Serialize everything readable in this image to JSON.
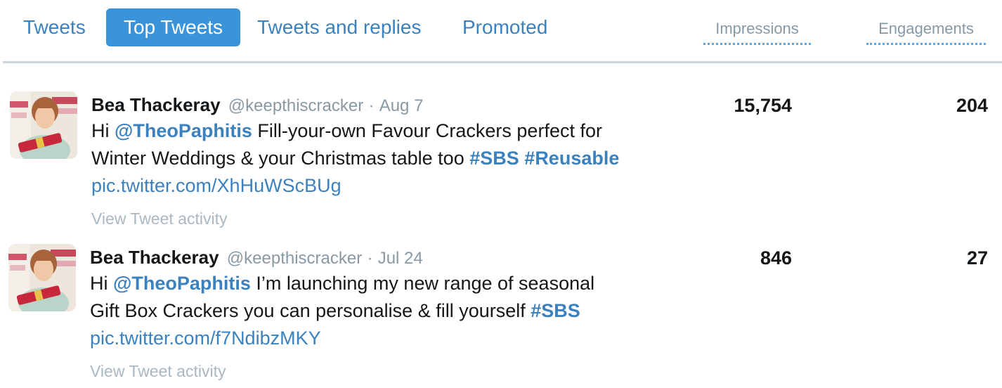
{
  "tabs": [
    {
      "label": "Tweets",
      "active": false
    },
    {
      "label": "Top Tweets",
      "active": true
    },
    {
      "label": "Tweets and replies",
      "active": false
    },
    {
      "label": "Promoted",
      "active": false
    }
  ],
  "columns": {
    "impressions": "Impressions",
    "engagements": "Engagements"
  },
  "colors": {
    "accent": "#3b94d9",
    "link": "#3b81bd",
    "muted": "#8899a6",
    "divider": "#ccd6dd"
  },
  "tweets": [
    {
      "author_name": "Bea Thackeray",
      "handle": "@keepthiscracker",
      "separator": "·",
      "date": "Aug 7",
      "text_parts": {
        "p1": "Hi ",
        "mention": "@TheoPaphitis",
        "p2": " Fill-your-own Favour Crackers perfect for Winter Weddings & your Christmas table too ",
        "hashtag1": "#SBS",
        "hashtag2": "#Reusable",
        "pic": "pic.twitter.com/XhHuWScBUg"
      },
      "activity_label": "View Tweet activity",
      "impressions": "15,754",
      "engagements": "204"
    },
    {
      "author_name": "Bea Thackeray",
      "handle": "@keepthiscracker",
      "separator": "·",
      "date": "Jul 24",
      "text_parts": {
        "p1": "Hi ",
        "mention": "@TheoPaphitis",
        "p2": " I’m launching my new range of seasonal Gift Box Crackers you can personalise & fill yourself ",
        "hashtag1": "#SBS",
        "pic": "pic.twitter.com/f7NdibzMKY"
      },
      "activity_label": "View Tweet activity",
      "impressions": "846",
      "engagements": "27"
    }
  ]
}
